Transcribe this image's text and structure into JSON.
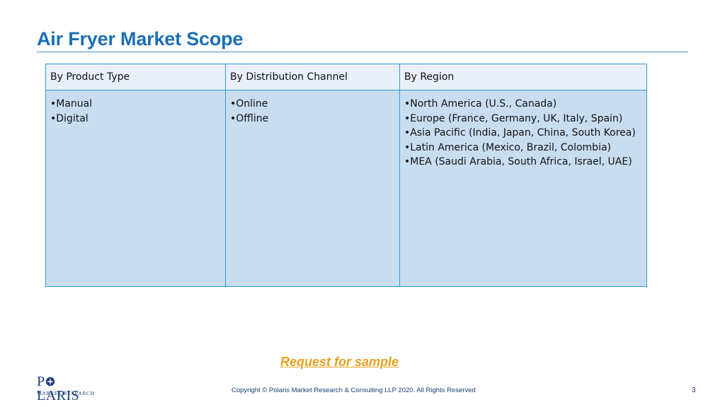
{
  "slide": {
    "title": "Air Fryer Market Scope",
    "page_number": "3"
  },
  "table": {
    "headers": [
      "By Product Type",
      "By Distribution Channel",
      "By Region"
    ],
    "columns": [
      [
        "•Manual",
        "•Digital"
      ],
      [
        "•Online",
        "•Offline"
      ],
      [
        "•North America (U.S., Canada)",
        "•Europe (France, Germany, UK, Italy, Spain)",
        "•Asia Pacific (India, Japan, China, South Korea)",
        "•Latin America (Mexico, Brazil, Colombia)",
        "•MEA (Saudi Arabia, South Africa, Israel, UAE)"
      ]
    ]
  },
  "cta": {
    "label": "Request for sample"
  },
  "footer": {
    "logo_word": "POLARIS",
    "logo_sub": "MARKET RESEARCH",
    "copyright": "Copyright © Polaris Market Research & Consulting LLP 2020. All Rights Reserved"
  },
  "colors": {
    "title": "#1a6fb5",
    "table_header_bg": "#e9f0f9",
    "table_body_bg": "#c9ddf1",
    "table_border": "#2e9bd6",
    "cta": "#e8a020",
    "brand_navy": "#1c3f7a"
  }
}
